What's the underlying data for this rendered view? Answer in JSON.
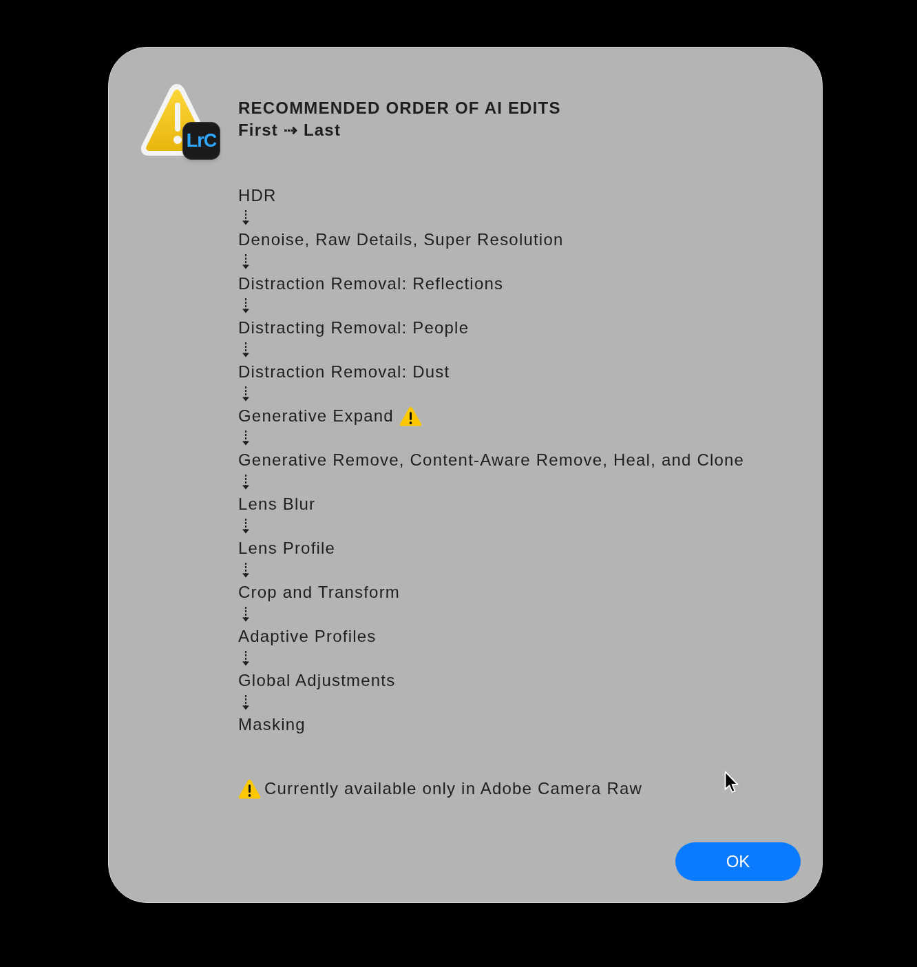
{
  "dialog": {
    "app_icon": {
      "badge": "LrC"
    },
    "title": "RECOMMENDED ORDER OF AI EDITS",
    "subtitle": "First ⇢ Last",
    "steps": [
      {
        "label": "HDR",
        "warning": false
      },
      {
        "label": "Denoise, Raw Details, Super Resolution",
        "warning": false
      },
      {
        "label": "Distraction Removal: Reflections",
        "warning": false
      },
      {
        "label": "Distracting Removal: People",
        "warning": false
      },
      {
        "label": "Distraction Removal: Dust",
        "warning": false
      },
      {
        "label": "Generative Expand",
        "warning": true
      },
      {
        "label": "Generative Remove, Content-Aware Remove, Heal, and Clone",
        "warning": false
      },
      {
        "label": "Lens Blur",
        "warning": false
      },
      {
        "label": "Lens Profile",
        "warning": false
      },
      {
        "label": "Crop and Transform",
        "warning": false
      },
      {
        "label": "Adaptive Profiles",
        "warning": false
      },
      {
        "label": "Global Adjustments",
        "warning": false
      },
      {
        "label": "Masking",
        "warning": false
      }
    ],
    "footnote": "Currently available only in Adobe Camera Raw",
    "buttons": [
      {
        "label": "OK",
        "default": true
      }
    ]
  }
}
